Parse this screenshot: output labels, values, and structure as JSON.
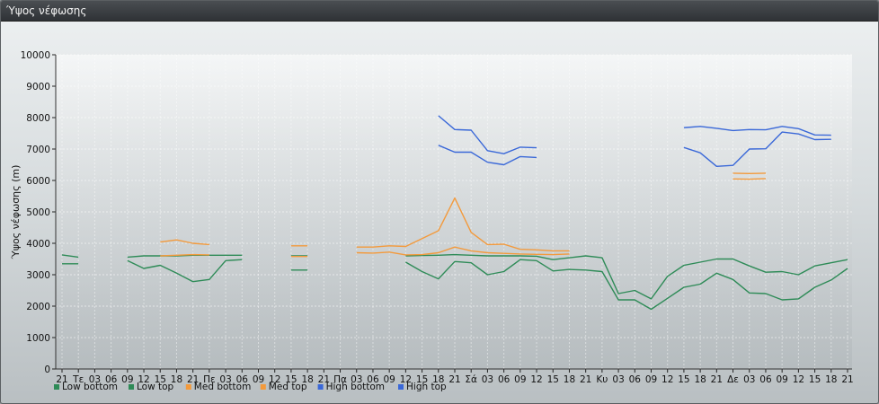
{
  "window": {
    "title": "Ύψος νέφωσης"
  },
  "chart_data": {
    "type": "line",
    "ylabel": "Ύψος νέφωσης (m)",
    "ylim": [
      0,
      10000
    ],
    "yticks": [
      0,
      1000,
      2000,
      3000,
      4000,
      5000,
      6000,
      7000,
      8000,
      9000,
      10000
    ],
    "grid": true,
    "legend_position": "bottom-left",
    "categories": [
      "21",
      "Τε",
      "03",
      "06",
      "09",
      "12",
      "15",
      "18",
      "21",
      "Πε",
      "03",
      "06",
      "09",
      "12",
      "15",
      "18",
      "21",
      "Πα",
      "03",
      "06",
      "09",
      "12",
      "15",
      "18",
      "21",
      "Σά",
      "03",
      "06",
      "09",
      "12",
      "15",
      "18",
      "21",
      "Κυ",
      "03",
      "06",
      "09",
      "12",
      "15",
      "18",
      "21",
      "Δε",
      "03",
      "06",
      "09",
      "12",
      "15",
      "18",
      "21"
    ],
    "series": [
      {
        "name": "Low bottom",
        "color": "#2e8b57",
        "values": [
          3350,
          3350,
          null,
          null,
          3450,
          3200,
          3300,
          3050,
          2780,
          2850,
          3450,
          3480,
          null,
          null,
          3150,
          3150,
          null,
          null,
          null,
          null,
          null,
          3400,
          3100,
          2870,
          3420,
          3380,
          3000,
          3100,
          3480,
          3450,
          3120,
          3170,
          3150,
          3100,
          2200,
          2200,
          1900,
          2250,
          2600,
          2700,
          3050,
          2850,
          2420,
          2400,
          2200,
          2230,
          2600,
          2830,
          3200
        ]
      },
      {
        "name": "Low top",
        "color": "#2e8b57",
        "values": [
          3630,
          3560,
          null,
          null,
          3560,
          3600,
          3600,
          3600,
          3620,
          3620,
          3620,
          3620,
          null,
          null,
          3600,
          3600,
          null,
          null,
          null,
          null,
          null,
          3600,
          3610,
          3620,
          3640,
          3620,
          3600,
          3600,
          3600,
          3590,
          3480,
          3540,
          3600,
          3540,
          2400,
          2500,
          2230,
          2950,
          3300,
          3400,
          3500,
          3500,
          3280,
          3080,
          3100,
          3000,
          3280,
          3380,
          3480
        ]
      },
      {
        "name": "Med bottom",
        "color": "#f39a3c",
        "values": [
          null,
          null,
          null,
          null,
          null,
          null,
          3600,
          3620,
          3640,
          3630,
          null,
          null,
          null,
          null,
          3580,
          3580,
          null,
          null,
          3700,
          3690,
          3720,
          3630,
          3640,
          3700,
          3880,
          3760,
          3700,
          3680,
          3660,
          3650,
          3640,
          3660,
          null,
          null,
          null,
          null,
          null,
          null,
          null,
          null,
          null,
          6050,
          6040,
          6060,
          null,
          null,
          null,
          null,
          null
        ]
      },
      {
        "name": "Med top",
        "color": "#f39a3c",
        "values": [
          null,
          null,
          null,
          null,
          null,
          null,
          4040,
          4110,
          4000,
          3960,
          null,
          null,
          null,
          null,
          3920,
          3920,
          null,
          null,
          3880,
          3880,
          3920,
          3900,
          4150,
          4400,
          5440,
          4350,
          3960,
          3970,
          3810,
          3790,
          3760,
          3760,
          null,
          null,
          null,
          null,
          null,
          null,
          null,
          null,
          null,
          6230,
          6220,
          6230,
          null,
          null,
          null,
          null,
          null
        ]
      },
      {
        "name": "High bottom",
        "color": "#3a68d8",
        "values": [
          null,
          null,
          null,
          null,
          null,
          null,
          null,
          null,
          null,
          null,
          null,
          null,
          null,
          null,
          null,
          null,
          null,
          null,
          null,
          null,
          null,
          null,
          null,
          7120,
          6900,
          6900,
          6580,
          6500,
          6760,
          6730,
          null,
          null,
          null,
          null,
          null,
          null,
          null,
          null,
          7050,
          6880,
          6450,
          6480,
          7000,
          7010,
          7540,
          7480,
          7300,
          7310,
          null
        ]
      },
      {
        "name": "High top",
        "color": "#3a68d8",
        "values": [
          null,
          null,
          null,
          null,
          null,
          null,
          null,
          null,
          null,
          null,
          null,
          null,
          null,
          null,
          null,
          null,
          null,
          null,
          null,
          null,
          null,
          null,
          null,
          8060,
          7620,
          7600,
          6950,
          6850,
          7060,
          7040,
          null,
          null,
          null,
          null,
          null,
          null,
          null,
          null,
          7680,
          7720,
          7660,
          7590,
          7620,
          7610,
          7720,
          7650,
          7450,
          7440,
          null
        ]
      }
    ]
  }
}
